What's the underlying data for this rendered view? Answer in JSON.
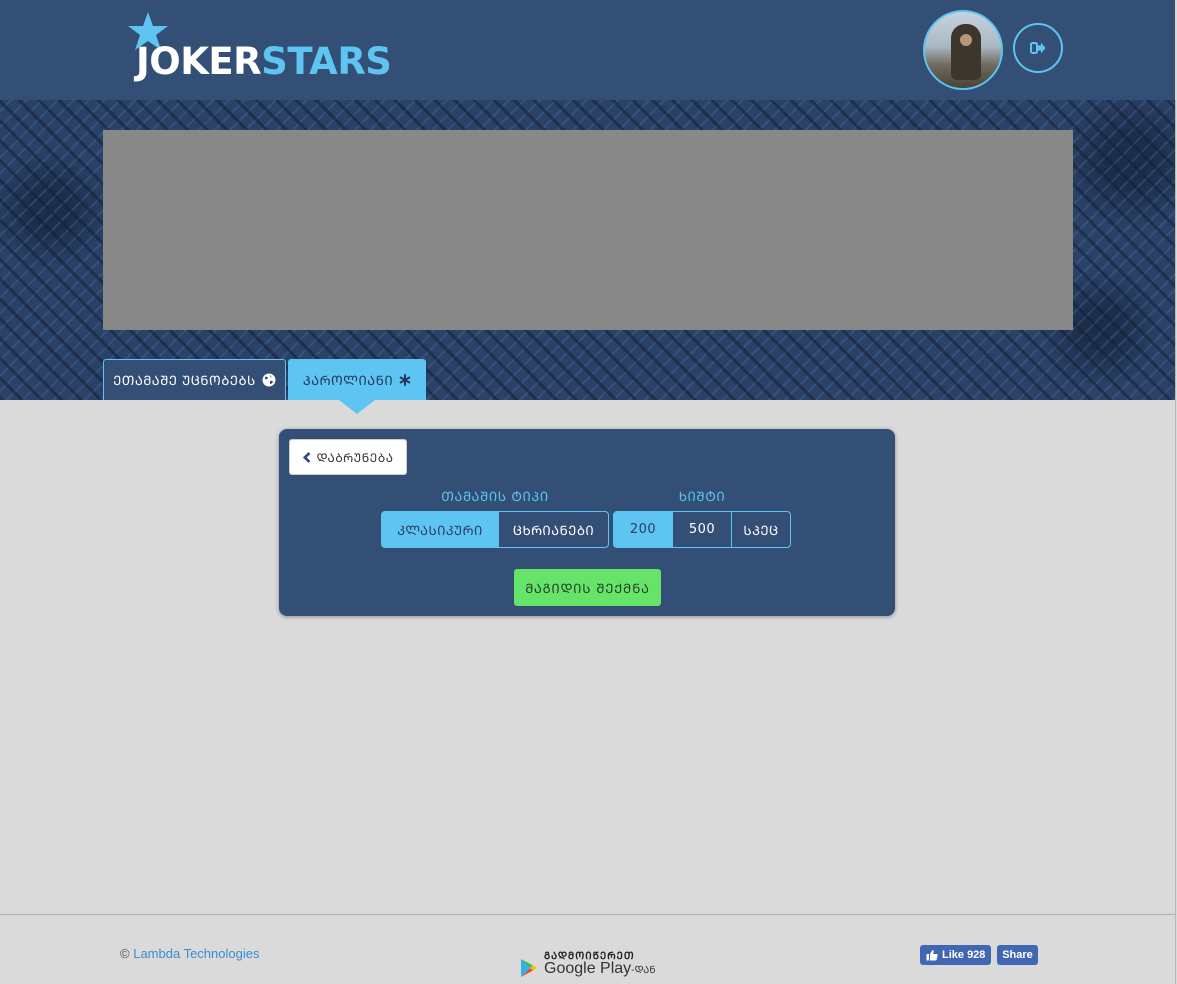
{
  "header": {
    "logo_part1": "JOKER",
    "logo_part2": "STARS",
    "avatar_alt": "user avatar",
    "logout_icon": "sign-out-icon"
  },
  "tabs": [
    {
      "label": "ᲔᲗᲐᲛᲐᲨᲔ ᲣᲪᲜᲝᲑᲔᲑᲡ",
      "icon": "globe-icon",
      "active": false
    },
    {
      "label": "ᲞᲐᲠᲝᲚᲘᲐᲜᲘ",
      "icon": "asterisk-icon",
      "active": true
    }
  ],
  "panel": {
    "back_label": "ᲓᲐᲑᲠᲣᲜᲔᲑᲐ",
    "game_type": {
      "label": "ᲗᲐᲛᲐᲨᲘᲡ ᲢᲘᲞᲘ",
      "options": [
        "ᲙᲚᲐᲡᲘᲙᲣᲠᲘ",
        "ᲪᲮᲠᲘᲐᲜᲔᲑᲘ"
      ],
      "selected": "ᲙᲚᲐᲡᲘᲙᲣᲠᲘ"
    },
    "bet": {
      "label": "ᲮᲘᲨᲢᲘ",
      "options": [
        "200",
        "500",
        "ᲡᲞᲔᲪ"
      ],
      "selected": "200"
    },
    "create_label": "ᲛᲐᲒᲘᲓᲘᲡ ᲨᲔᲥᲛᲜᲐ"
  },
  "footer": {
    "copyright_symbol": "©",
    "company": "Lambda Technologies",
    "gplay_top": "ᲒᲐᲓᲛᲝᲘᲬᲔᲠᲔᲗ",
    "gplay_main": "Google Play",
    "gplay_suffix": "-ᲓᲐᲜ",
    "fb_like": "Like 928",
    "fb_share": "Share"
  },
  "colors": {
    "header_bg": "#344f75",
    "accent": "#5ec4f1",
    "create_button": "#66e46a",
    "page_bg": "#dadada"
  }
}
